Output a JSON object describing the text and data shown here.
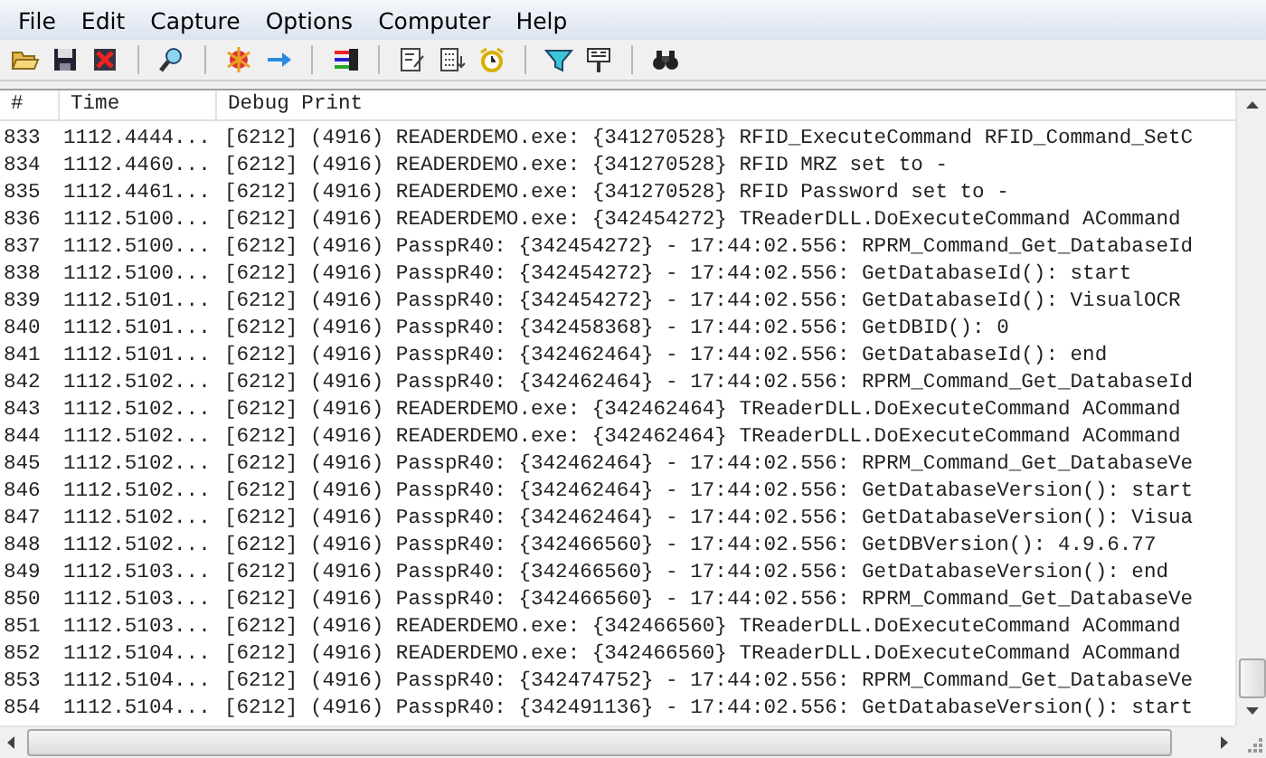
{
  "menu": [
    "File",
    "Edit",
    "Capture",
    "Options",
    "Computer",
    "Help"
  ],
  "table": {
    "columns": [
      "#",
      "Time",
      "Debug Print"
    ],
    "rows": [
      [
        "833",
        "1112.4444...",
        "[6212] (4916) READERDEMO.exe: {341270528} RFID_ExecuteCommand RFID_Command_SetC"
      ],
      [
        "834",
        "1112.4460...",
        "[6212] (4916) READERDEMO.exe: {341270528} RFID MRZ set to -"
      ],
      [
        "835",
        "1112.4461...",
        "[6212] (4916) READERDEMO.exe: {341270528} RFID Password set to -"
      ],
      [
        "836",
        "1112.5100...",
        "[6212] (4916) READERDEMO.exe: {342454272} TReaderDLL.DoExecuteCommand ACommand"
      ],
      [
        "837",
        "1112.5100...",
        "[6212] (4916) PasspR40: {342454272} - 17:44:02.556: RPRM_Command_Get_DatabaseId"
      ],
      [
        "838",
        "1112.5100...",
        "[6212] (4916) PasspR40: {342454272} - 17:44:02.556: GetDatabaseId(): start"
      ],
      [
        "839",
        "1112.5101...",
        "[6212] (4916) PasspR40: {342454272} - 17:44:02.556: GetDatabaseId(): VisualOCR"
      ],
      [
        "840",
        "1112.5101...",
        "[6212] (4916) PasspR40: {342458368} - 17:44:02.556: GetDBID(): 0"
      ],
      [
        "841",
        "1112.5101...",
        "[6212] (4916) PasspR40: {342462464} - 17:44:02.556: GetDatabaseId(): end"
      ],
      [
        "842",
        "1112.5102...",
        "[6212] (4916) PasspR40: {342462464} - 17:44:02.556: RPRM_Command_Get_DatabaseId"
      ],
      [
        "843",
        "1112.5102...",
        "[6212] (4916) READERDEMO.exe: {342462464} TReaderDLL.DoExecuteCommand ACommand"
      ],
      [
        "844",
        "1112.5102...",
        "[6212] (4916) READERDEMO.exe: {342462464} TReaderDLL.DoExecuteCommand ACommand"
      ],
      [
        "845",
        "1112.5102...",
        "[6212] (4916) PasspR40: {342462464} - 17:44:02.556: RPRM_Command_Get_DatabaseVe"
      ],
      [
        "846",
        "1112.5102...",
        "[6212] (4916) PasspR40: {342462464} - 17:44:02.556: GetDatabaseVersion(): start"
      ],
      [
        "847",
        "1112.5102...",
        "[6212] (4916) PasspR40: {342462464} - 17:44:02.556: GetDatabaseVersion(): Visua"
      ],
      [
        "848",
        "1112.5102...",
        "[6212] (4916) PasspR40: {342466560} - 17:44:02.556: GetDBVersion(): 4.9.6.77"
      ],
      [
        "849",
        "1112.5103...",
        "[6212] (4916) PasspR40: {342466560} - 17:44:02.556: GetDatabaseVersion(): end"
      ],
      [
        "850",
        "1112.5103...",
        "[6212] (4916) PasspR40: {342466560} - 17:44:02.556: RPRM_Command_Get_DatabaseVe"
      ],
      [
        "851",
        "1112.5103...",
        "[6212] (4916) READERDEMO.exe: {342466560} TReaderDLL.DoExecuteCommand ACommand"
      ],
      [
        "852",
        "1112.5104...",
        "[6212] (4916) READERDEMO.exe: {342466560} TReaderDLL.DoExecuteCommand ACommand"
      ],
      [
        "853",
        "1112.5104...",
        "[6212] (4916) PasspR40: {342474752} - 17:44:02.556: RPRM_Command_Get_DatabaseVe"
      ],
      [
        "854",
        "1112.5104...",
        "[6212] (4916) PasspR40: {342491136} - 17:44:02.556: GetDatabaseVersion(): start"
      ]
    ]
  }
}
